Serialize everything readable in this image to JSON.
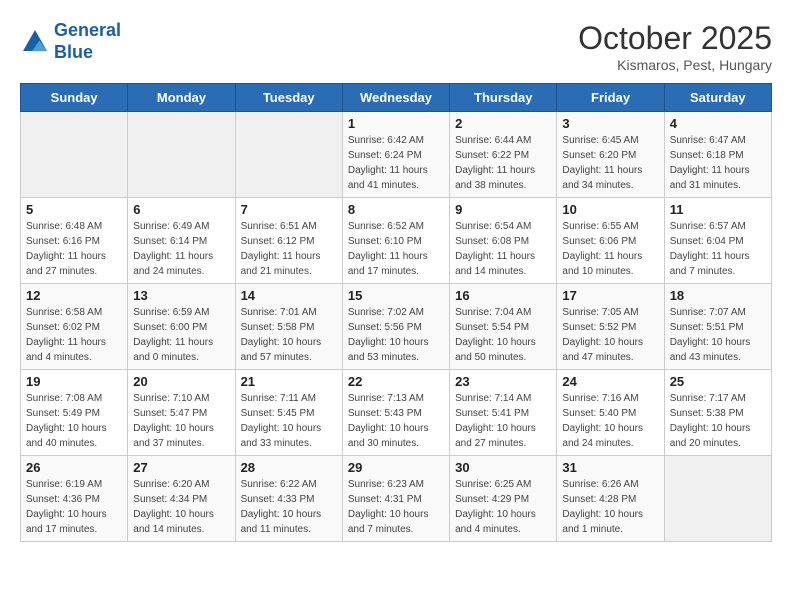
{
  "logo": {
    "line1": "General",
    "line2": "Blue"
  },
  "title": "October 2025",
  "subtitle": "Kismaros, Pest, Hungary",
  "days_of_week": [
    "Sunday",
    "Monday",
    "Tuesday",
    "Wednesday",
    "Thursday",
    "Friday",
    "Saturday"
  ],
  "weeks": [
    [
      {
        "day": "",
        "info": ""
      },
      {
        "day": "",
        "info": ""
      },
      {
        "day": "",
        "info": ""
      },
      {
        "day": "1",
        "info": "Sunrise: 6:42 AM\nSunset: 6:24 PM\nDaylight: 11 hours\nand 41 minutes."
      },
      {
        "day": "2",
        "info": "Sunrise: 6:44 AM\nSunset: 6:22 PM\nDaylight: 11 hours\nand 38 minutes."
      },
      {
        "day": "3",
        "info": "Sunrise: 6:45 AM\nSunset: 6:20 PM\nDaylight: 11 hours\nand 34 minutes."
      },
      {
        "day": "4",
        "info": "Sunrise: 6:47 AM\nSunset: 6:18 PM\nDaylight: 11 hours\nand 31 minutes."
      }
    ],
    [
      {
        "day": "5",
        "info": "Sunrise: 6:48 AM\nSunset: 6:16 PM\nDaylight: 11 hours\nand 27 minutes."
      },
      {
        "day": "6",
        "info": "Sunrise: 6:49 AM\nSunset: 6:14 PM\nDaylight: 11 hours\nand 24 minutes."
      },
      {
        "day": "7",
        "info": "Sunrise: 6:51 AM\nSunset: 6:12 PM\nDaylight: 11 hours\nand 21 minutes."
      },
      {
        "day": "8",
        "info": "Sunrise: 6:52 AM\nSunset: 6:10 PM\nDaylight: 11 hours\nand 17 minutes."
      },
      {
        "day": "9",
        "info": "Sunrise: 6:54 AM\nSunset: 6:08 PM\nDaylight: 11 hours\nand 14 minutes."
      },
      {
        "day": "10",
        "info": "Sunrise: 6:55 AM\nSunset: 6:06 PM\nDaylight: 11 hours\nand 10 minutes."
      },
      {
        "day": "11",
        "info": "Sunrise: 6:57 AM\nSunset: 6:04 PM\nDaylight: 11 hours\nand 7 minutes."
      }
    ],
    [
      {
        "day": "12",
        "info": "Sunrise: 6:58 AM\nSunset: 6:02 PM\nDaylight: 11 hours\nand 4 minutes."
      },
      {
        "day": "13",
        "info": "Sunrise: 6:59 AM\nSunset: 6:00 PM\nDaylight: 11 hours\nand 0 minutes."
      },
      {
        "day": "14",
        "info": "Sunrise: 7:01 AM\nSunset: 5:58 PM\nDaylight: 10 hours\nand 57 minutes."
      },
      {
        "day": "15",
        "info": "Sunrise: 7:02 AM\nSunset: 5:56 PM\nDaylight: 10 hours\nand 53 minutes."
      },
      {
        "day": "16",
        "info": "Sunrise: 7:04 AM\nSunset: 5:54 PM\nDaylight: 10 hours\nand 50 minutes."
      },
      {
        "day": "17",
        "info": "Sunrise: 7:05 AM\nSunset: 5:52 PM\nDaylight: 10 hours\nand 47 minutes."
      },
      {
        "day": "18",
        "info": "Sunrise: 7:07 AM\nSunset: 5:51 PM\nDaylight: 10 hours\nand 43 minutes."
      }
    ],
    [
      {
        "day": "19",
        "info": "Sunrise: 7:08 AM\nSunset: 5:49 PM\nDaylight: 10 hours\nand 40 minutes."
      },
      {
        "day": "20",
        "info": "Sunrise: 7:10 AM\nSunset: 5:47 PM\nDaylight: 10 hours\nand 37 minutes."
      },
      {
        "day": "21",
        "info": "Sunrise: 7:11 AM\nSunset: 5:45 PM\nDaylight: 10 hours\nand 33 minutes."
      },
      {
        "day": "22",
        "info": "Sunrise: 7:13 AM\nSunset: 5:43 PM\nDaylight: 10 hours\nand 30 minutes."
      },
      {
        "day": "23",
        "info": "Sunrise: 7:14 AM\nSunset: 5:41 PM\nDaylight: 10 hours\nand 27 minutes."
      },
      {
        "day": "24",
        "info": "Sunrise: 7:16 AM\nSunset: 5:40 PM\nDaylight: 10 hours\nand 24 minutes."
      },
      {
        "day": "25",
        "info": "Sunrise: 7:17 AM\nSunset: 5:38 PM\nDaylight: 10 hours\nand 20 minutes."
      }
    ],
    [
      {
        "day": "26",
        "info": "Sunrise: 6:19 AM\nSunset: 4:36 PM\nDaylight: 10 hours\nand 17 minutes."
      },
      {
        "day": "27",
        "info": "Sunrise: 6:20 AM\nSunset: 4:34 PM\nDaylight: 10 hours\nand 14 minutes."
      },
      {
        "day": "28",
        "info": "Sunrise: 6:22 AM\nSunset: 4:33 PM\nDaylight: 10 hours\nand 11 minutes."
      },
      {
        "day": "29",
        "info": "Sunrise: 6:23 AM\nSunset: 4:31 PM\nDaylight: 10 hours\nand 7 minutes."
      },
      {
        "day": "30",
        "info": "Sunrise: 6:25 AM\nSunset: 4:29 PM\nDaylight: 10 hours\nand 4 minutes."
      },
      {
        "day": "31",
        "info": "Sunrise: 6:26 AM\nSunset: 4:28 PM\nDaylight: 10 hours\nand 1 minute."
      },
      {
        "day": "",
        "info": ""
      }
    ]
  ]
}
